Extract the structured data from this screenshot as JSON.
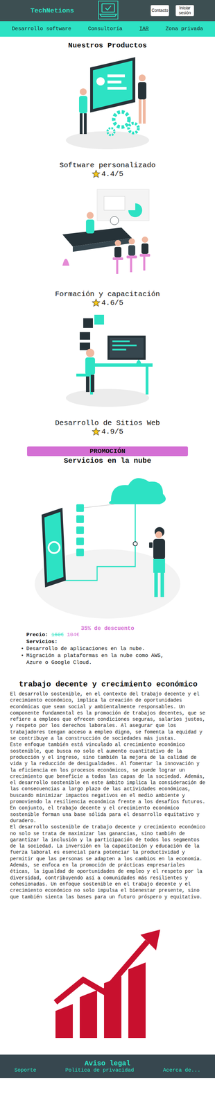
{
  "header": {
    "logo": "TechNetions",
    "buttons": [
      "Contacto",
      "Iniciar sesión"
    ]
  },
  "nav": [
    {
      "label": "Desarrollo software",
      "selected": false
    },
    {
      "label": "Consultoría",
      "selected": false
    },
    {
      "label": "IAR",
      "selected": true
    },
    {
      "label": "Zona privada",
      "selected": false
    }
  ],
  "products": {
    "title": "Nuestros Productos",
    "items": [
      {
        "name": "Software personalizado",
        "rating": "4.4/5",
        "kind": "software"
      },
      {
        "name": "Formación y capacitación",
        "rating": "4.6/5",
        "kind": "training"
      },
      {
        "name": "Desarrollo de Sitios Web",
        "rating": "4.9/5",
        "kind": "web"
      }
    ]
  },
  "promotion": {
    "badge": "PROMOCIÓN",
    "title": "Servicios en la nube",
    "discount": "35% de descuento",
    "price_label": "Precio:",
    "old_price": "160€",
    "new_price": "104€",
    "services_label": "Servicios:",
    "services": [
      "Desarrollo de aplicaciones en la nube.",
      "Migración a plataformas en la nube como AWS, Azure o Google Cloud."
    ]
  },
  "article": {
    "title": "trabajo decente y crecimiento económico",
    "paragraphs": [
      "El desarrollo sostenible, en el contexto del trabajo decente y el crecimiento económico, implica la creación de oportunidades económicas que sean social y ambientalmente responsables. Un componente fundamental es la promoción de trabajos decentes, que se refiere a empleos que ofrecen condiciones seguras, salarios justos, y respeto por los derechos laborales. Al asegurar que los trabajadores tengan acceso a empleo digno, se fomenta la equidad y se contribuye a la construcción de sociedades más justas.",
      "Este enfoque también está vinculado al crecimiento económico sostenible, que busca no solo el aumento cuantitativo de la producción y el ingreso, sino también la mejora de la calidad de vida y la reducción de desigualdades. Al fomentar la innovación y la eficiencia en los procesos económicos, se puede lograr un crecimiento que beneficie a todas las capas de la sociedad. Además, el desarrollo sostenible en este ámbito implica la consideración de las consecuencias a largo plazo de las actividades económicas, buscando minimizar impactos negativos en el medio ambiente y promoviendo la resiliencia económica frente a los desafíos futuros. En conjunto, el trabajo decente y el crecimiento económico sostenible forman una base sólida para el desarrollo equitativo y duradero.",
      "El desarrollo sostenible de trabajo decente y crecimiento económico no solo se trata de maximizar las ganancias, sino también de garantizar la inclusión y la participación de todos los segmentos de la sociedad. La inversión en la capacitación y educación de la fuerza laboral es esencial para potenciar la productividad y permitir que las personas se adapten a los cambios en la economía. Además, se enfoca en la promoción de prácticas empresariales éticas, la igualdad de oportunidades de empleo y el respeto por la diversidad, contribuyendo así a comunidades más resilientes y cohesionadas. Un enfoque sostenible en el trabajo decente y el crecimiento económico no solo impulsa el bienestar presente, sino que también sienta las bases para un futuro próspero y equitativo."
    ]
  },
  "footer": {
    "title": "Aviso legal",
    "links": [
      "Soporte",
      "Política de privacidad",
      "Acerca de..."
    ]
  }
}
